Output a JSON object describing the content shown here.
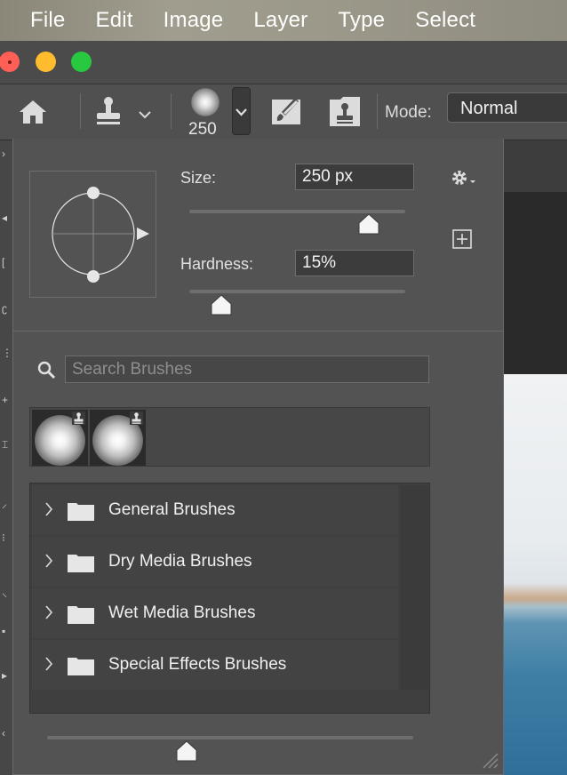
{
  "menubar": {
    "items": [
      "File",
      "Edit",
      "Image",
      "Layer",
      "Type",
      "Select"
    ]
  },
  "options_bar": {
    "brush_size": "250",
    "mode_label": "Mode:",
    "mode_value": "Normal",
    "icons": [
      "home-icon",
      "clone-stamp-icon",
      "brush-preset-icon",
      "toggle-brush-settings-icon",
      "toggle-clone-source-icon"
    ]
  },
  "brush_panel": {
    "size_label": "Size:",
    "size_value": "250 px",
    "size_level": 0.83,
    "hardness_label": "Hardness:",
    "hardness_value": "15%",
    "hardness_level": 0.15,
    "search_placeholder": "Search Brushes",
    "recent_count": 2,
    "folders": [
      {
        "label": "General Brushes"
      },
      {
        "label": "Dry Media Brushes"
      },
      {
        "label": "Wet Media Brushes"
      },
      {
        "label": "Special Effects Brushes"
      }
    ],
    "preview_size_level": 0.38
  },
  "colors": {
    "panel_bg": "#535353",
    "field_bg": "#3c3c3c",
    "traffic_red": "#ff5f57",
    "traffic_yellow": "#febc2e",
    "traffic_green": "#28c840"
  }
}
